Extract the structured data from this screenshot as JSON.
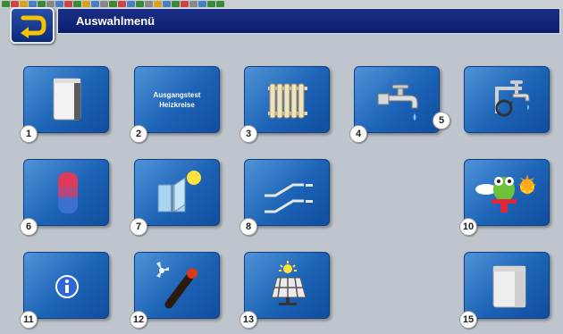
{
  "header": {
    "title": "Auswahlmenü"
  },
  "tiles": [
    {
      "number": "1",
      "icon": "boiler-icon"
    },
    {
      "number": "2",
      "label_line1": "Ausgangstest",
      "label_line2": "Heizkreise",
      "icon": ""
    },
    {
      "number": "3",
      "icon": "radiator-icon"
    },
    {
      "number": "4",
      "icon": "water-tap-icon"
    },
    {
      "number": "5",
      "icon": "tap-circulation-icon"
    },
    {
      "number": "6",
      "icon": "storage-tank-icon"
    },
    {
      "number": "7",
      "icon": "solar-window-icon"
    },
    {
      "number": "8",
      "icon": "ramp-switch-icon"
    },
    {
      "number": "10",
      "icon": "frog-heat-icon"
    },
    {
      "number": "11",
      "icon": "info-icon"
    },
    {
      "number": "12",
      "icon": "fan-sensor-icon"
    },
    {
      "number": "13",
      "icon": "solar-panel-icon"
    },
    {
      "number": "15",
      "icon": "appliance-icon"
    }
  ],
  "colors": {
    "tile": "#1c63b6",
    "title_bar": "#0c1f6e",
    "background": "#bfc5cc"
  }
}
